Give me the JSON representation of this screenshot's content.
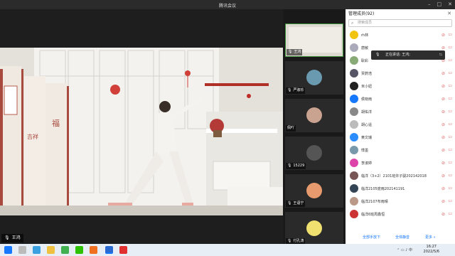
{
  "window": {
    "title": "腾讯会议"
  },
  "main": {
    "speaker_name": "王鸿"
  },
  "thumbnails": [
    {
      "name": "王鸿"
    },
    {
      "name": "严淑珍"
    },
    {
      "name": "佩吖"
    },
    {
      "name": "15229"
    },
    {
      "name": "王语宁"
    },
    {
      "name": "付孔涛"
    }
  ],
  "panel": {
    "title": "管理成员(92)",
    "search_placeholder": "搜索成员",
    "speaking_banner": "正在讲话: 王鸿;",
    "members": [
      {
        "name": "rh林",
        "color": "#f1c40f"
      },
      {
        "name": "唐敏",
        "color": "#aab"
      },
      {
        "name": "耿彩",
        "color": "#8a7"
      },
      {
        "name": "贾蔚浩",
        "color": "#556"
      },
      {
        "name": "米小妞",
        "color": "#222"
      },
      {
        "name": "侯晓雨",
        "color": "#1677ff"
      },
      {
        "name": "胡佑洋",
        "color": "#888"
      },
      {
        "name": "胡心遥",
        "color": "#bbb"
      },
      {
        "name": "黄文瑞",
        "color": "#2b8cff"
      },
      {
        "name": "悸墨",
        "color": "#79a"
      },
      {
        "name": "李淑婷",
        "color": "#d4a"
      },
      {
        "name": "临洋（3+2）2101班许子骏202142018",
        "color": "#755"
      },
      {
        "name": "临洋2105庞雨202141191",
        "color": "#345"
      },
      {
        "name": "临洋2107布雨晴",
        "color": "#b98"
      },
      {
        "name": "临洋6班周鑫恒",
        "color": "#c33"
      }
    ],
    "footer": {
      "mute_all": "全部手放下",
      "all_mute": "全体静音",
      "more": "更多 »"
    }
  },
  "taskbar": {
    "time": "16:27",
    "date": "2022/5/6"
  }
}
